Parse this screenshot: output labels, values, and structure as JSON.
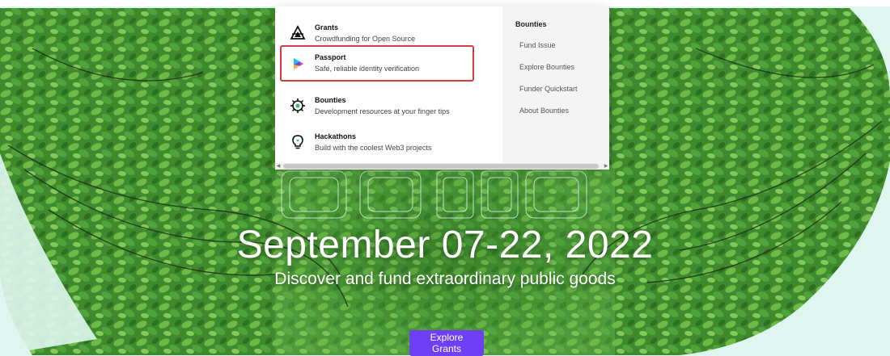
{
  "menu": {
    "products": [
      {
        "title": "Grants",
        "desc": "Crowdfunding for Open Source",
        "icon": "grants-icon"
      },
      {
        "title": "Passport",
        "desc": "Safe, reliable identity verification",
        "icon": "passport-icon"
      },
      {
        "title": "Bounties",
        "desc": "Development resources at your finger tips",
        "icon": "bounties-icon"
      },
      {
        "title": "Hackathons",
        "desc": "Build with the coolest Web3 projects",
        "icon": "hackathons-icon"
      }
    ],
    "side": {
      "heading": "Bounties",
      "links": [
        "Fund Issue",
        "Explore Bounties",
        "Funder Quickstart",
        "About Bounties"
      ]
    }
  },
  "hero": {
    "headline": "September 07-22, 2022",
    "subline": "Discover and fund extraordinary public goods",
    "cta": "Explore Grants"
  },
  "colors": {
    "accent": "#6f3ff5",
    "highlight_border": "#d63a3a",
    "leaf": "#3c8a2e"
  }
}
